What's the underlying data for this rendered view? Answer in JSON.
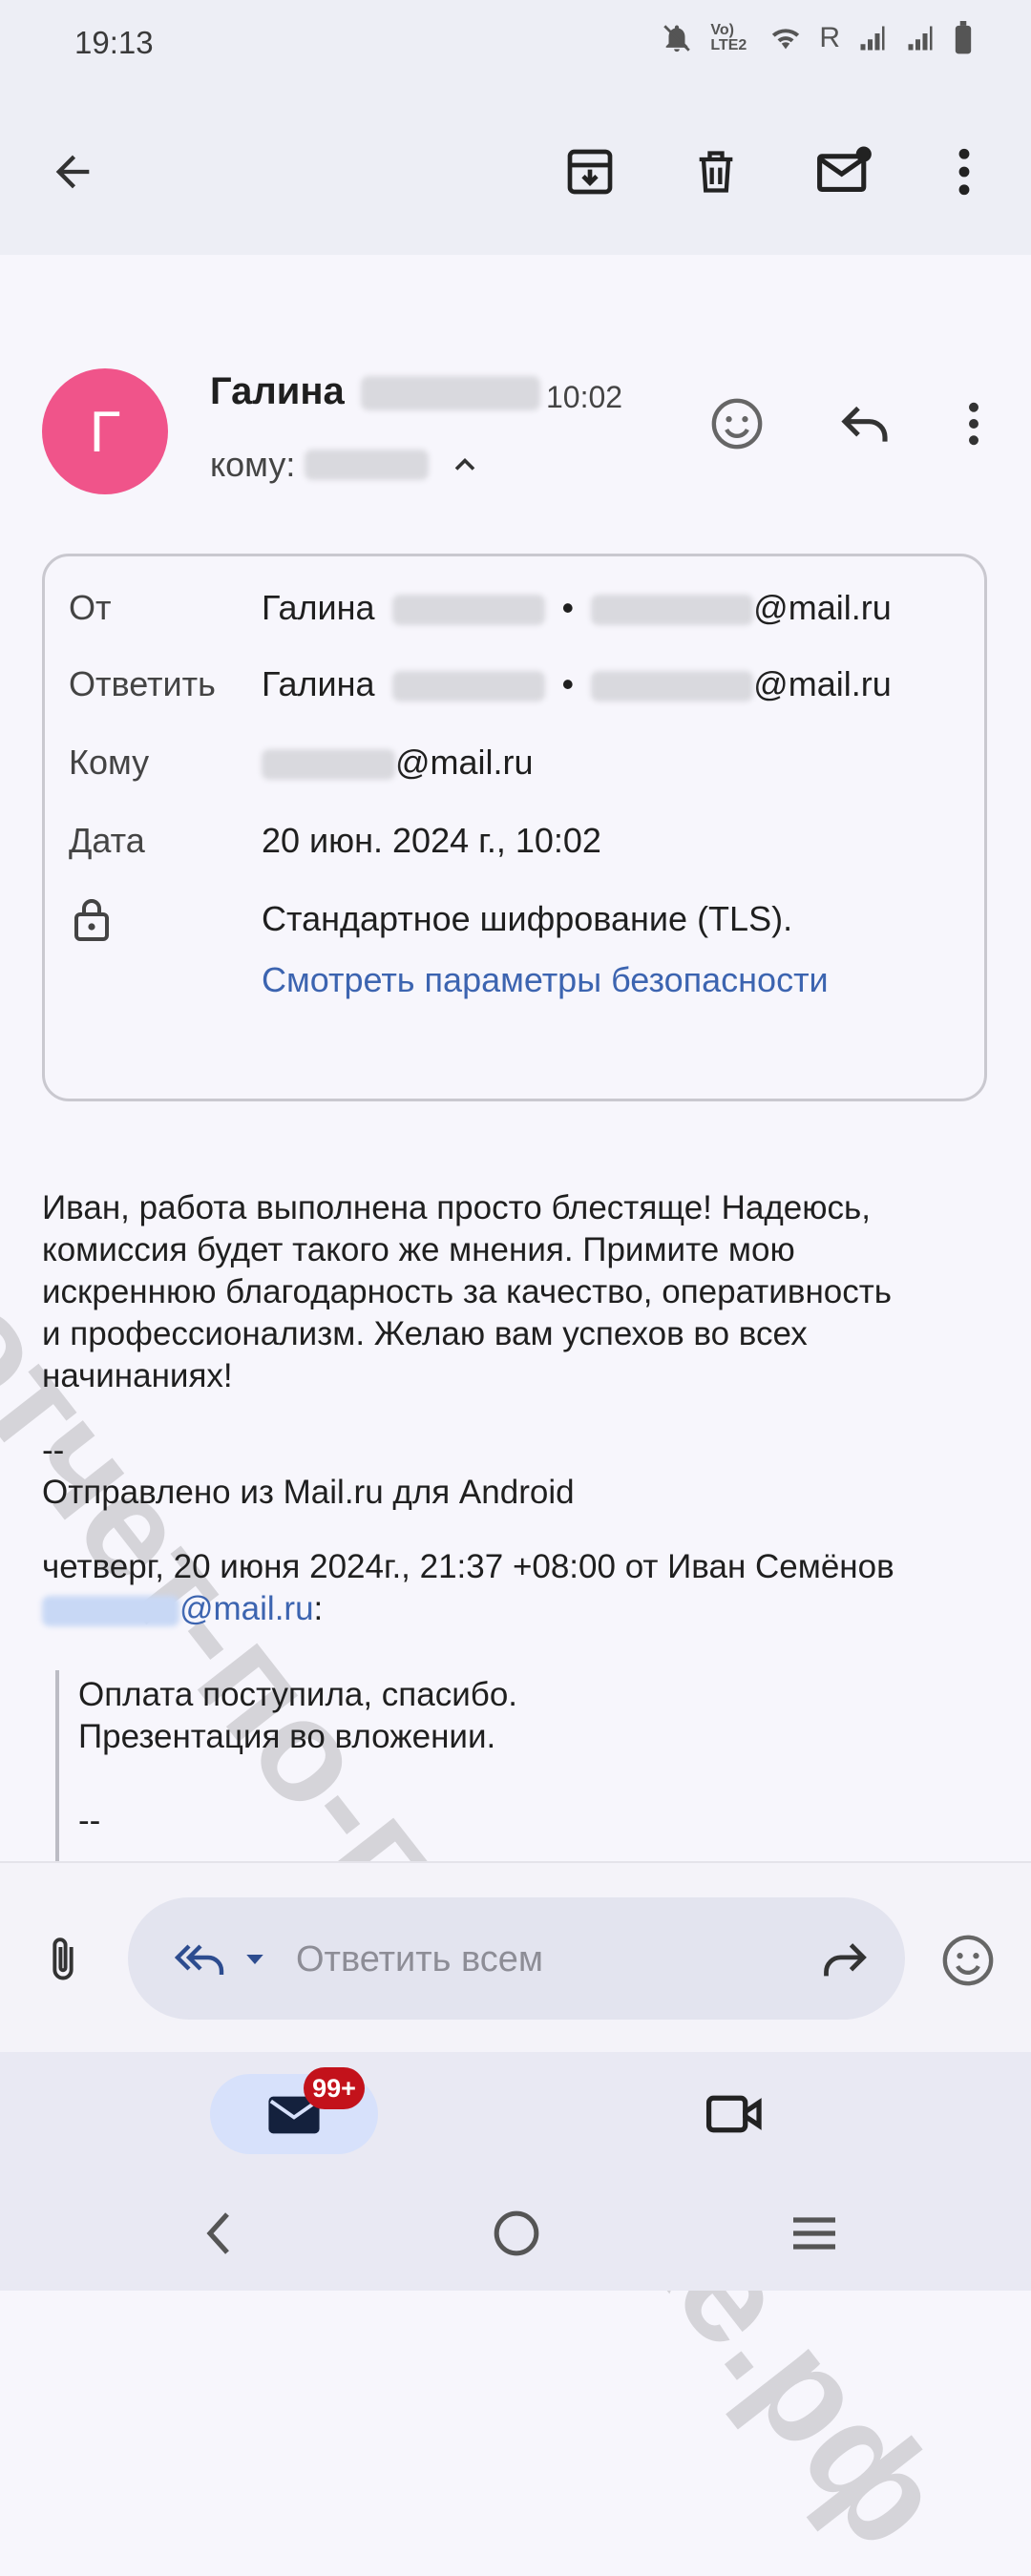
{
  "status_bar": {
    "time": "19:13",
    "network_label": "Vo) LTE2",
    "roaming": "R",
    "icons": [
      "bell-off-icon",
      "volte-icon",
      "wifi-icon",
      "signal-icon",
      "signal-icon",
      "battery-icon"
    ]
  },
  "toolbar": {
    "icons": [
      "back-arrow-icon",
      "archive-icon",
      "trash-icon",
      "mark-unread-icon",
      "more-vert-icon"
    ]
  },
  "header": {
    "avatar_letter": "Г",
    "sender_first_name": "Галина",
    "time": "10:02",
    "to_label": "кому:",
    "icons": [
      "emoji-add-icon",
      "reply-icon",
      "more-vert-icon"
    ]
  },
  "details": {
    "from_label": "От",
    "from_name": "Галина",
    "from_email_suffix": "@mail.ru",
    "reply_label": "Ответить",
    "reply_name": "Галина",
    "reply_email_suffix": "@mail.ru",
    "to_label": "Кому",
    "to_email_suffix": "@mail.ru",
    "date_label": "Дата",
    "date_value": "20 июн. 2024 г., 10:02",
    "encryption_text": "Стандартное шифрование (TLS).",
    "security_link": "Смотреть параметры безопасности"
  },
  "body": {
    "lines": [
      "Иван, работа выполнена просто блестяще! Надеюсь,",
      "комиссия будет такого же мнения. Примите мою",
      "искреннюю благодарность за качество, оперативность",
      "и профессионализм. Желаю вам успехов во всех",
      "начинаниях!"
    ],
    "signature_dashes": "--",
    "signature_text": "Отправлено из Mail.ru для Android",
    "quote_header": "четверг, 20 июня 2024г., 21:37 +08:00 от Иван Семёнов",
    "quote_email_suffix": "@mail.ru",
    "quote_email_colon": ":",
    "quote_lines": [
      "Оплата поступила, спасибо.",
      "Презентация во вложении."
    ],
    "quote_dashes": "--"
  },
  "watermark": "отчет-по-практике.рф",
  "reply_bar": {
    "placeholder": "Ответить всем",
    "icons": [
      "attach-icon",
      "reply-all-icon",
      "dropdown-icon",
      "forward-icon",
      "emoji-icon"
    ]
  },
  "bottom_nav": {
    "mail_badge": "99+",
    "icons": [
      "mail-icon",
      "video-icon"
    ]
  },
  "system_nav": {
    "icons": [
      "nav-back-icon",
      "nav-home-icon",
      "nav-recents-icon"
    ]
  },
  "colors": {
    "avatar": "#f0548a",
    "link": "#3c64b0",
    "badge": "#c3121b",
    "accent_pill": "#d7e1fb"
  }
}
